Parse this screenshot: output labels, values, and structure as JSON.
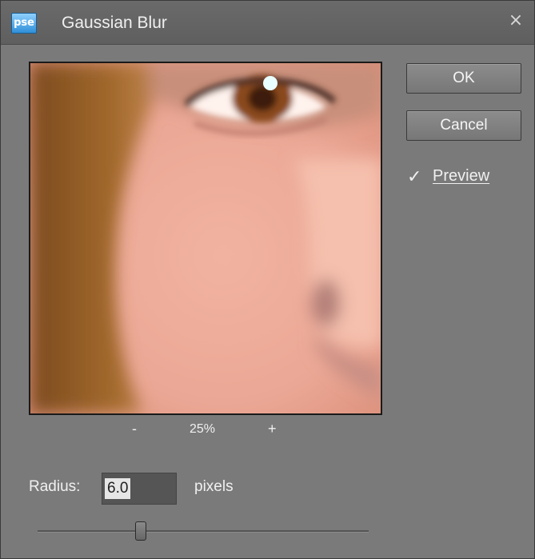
{
  "window": {
    "app_icon_text": "pse",
    "title": "Gaussian Blur",
    "close_icon": "close-icon"
  },
  "preview": {
    "zoom_out_label": "-",
    "zoom_level": "25%",
    "zoom_in_label": "+"
  },
  "buttons": {
    "ok": "OK",
    "cancel": "Cancel"
  },
  "preview_checkbox": {
    "checked": true,
    "checkmark": "✓",
    "label": "Preview"
  },
  "radius": {
    "label": "Radius:",
    "value": "6.0",
    "unit": "pixels"
  },
  "slider": {
    "min": 0.1,
    "max": 250,
    "value": 6.0,
    "display_fraction": 0.31
  },
  "colors": {
    "dialog_bg": "#7a7a7a",
    "titlebar": "#606060",
    "accent_icon": "#2f8fd8"
  }
}
